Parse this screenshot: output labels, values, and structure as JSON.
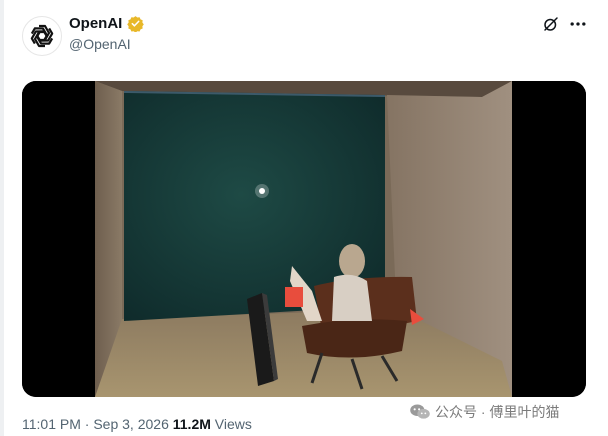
{
  "account": {
    "name": "OpenAI",
    "handle": "@OpenAI",
    "verified_color": "#e8b829"
  },
  "icons": {
    "avatar": "openai-logo-icon",
    "verified": "verified-badge-icon",
    "grok": "grok-icon",
    "more": "more-options-icon",
    "wechat": "wechat-icon"
  },
  "tweet": {
    "time": "11:01 PM",
    "separator": " · ",
    "date": "Sep 3, 2026",
    "views_count": "11.2M",
    "views_label": "Views"
  },
  "media": {
    "type": "video still",
    "description": "person seated in a chair facing a large dark screen in a small room"
  },
  "watermark": {
    "text": "公众号 · 傅里叶的猫"
  }
}
